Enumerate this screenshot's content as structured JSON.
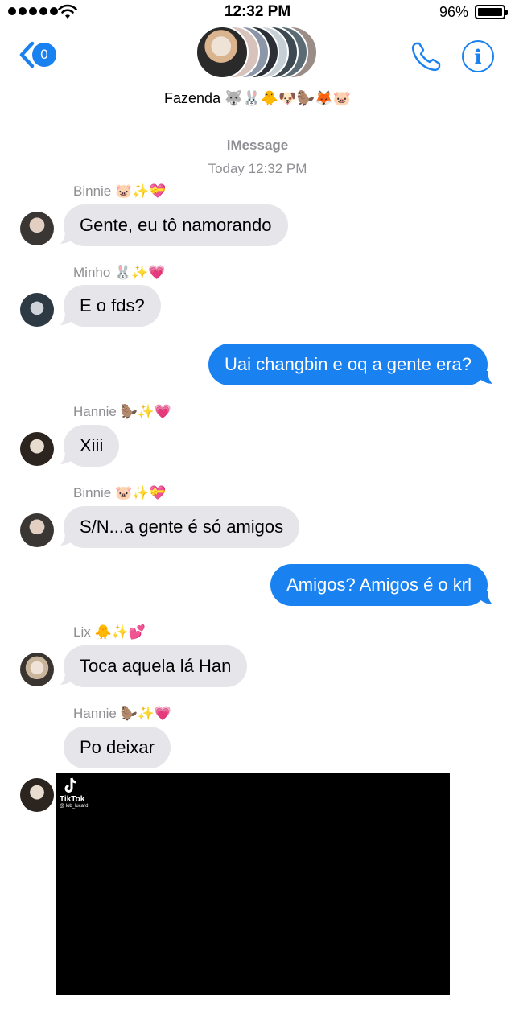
{
  "status_bar": {
    "time": "12:32 PM",
    "battery": "96%"
  },
  "header": {
    "back_badge": "0",
    "group_name": "Fazenda 🐺🐰🐥🐶🦫🦊🐷",
    "info_label": "i"
  },
  "chat": {
    "service": "iMessage",
    "timestamp": "Today 12:32 PM",
    "messages": [
      {
        "sender": "Binnie 🐷✨💝",
        "text": "Gente, eu tô namorando"
      },
      {
        "sender": "Minho 🐰✨💗",
        "text": "E o fds?"
      },
      {
        "text": "Uai changbin e oq a gente era?"
      },
      {
        "sender": "Hannie 🦫✨💗",
        "text": "Xiii"
      },
      {
        "sender": "Binnie 🐷✨💝",
        "text": "S/N...a gente é só amigos"
      },
      {
        "text": "Amigos? Amigos é o krl"
      },
      {
        "sender": "Lix 🐥✨💕",
        "text": "Toca aquela lá Han"
      },
      {
        "sender": "Hannie 🦫✨💗",
        "text": "Po deixar"
      }
    ],
    "video": {
      "brand": "TikTok",
      "handle": "@ lob_lucard"
    }
  },
  "colors": {
    "accent": "#1a82f0",
    "incoming_bubble": "#e5e5ea",
    "meta_text": "#8e8e93"
  }
}
